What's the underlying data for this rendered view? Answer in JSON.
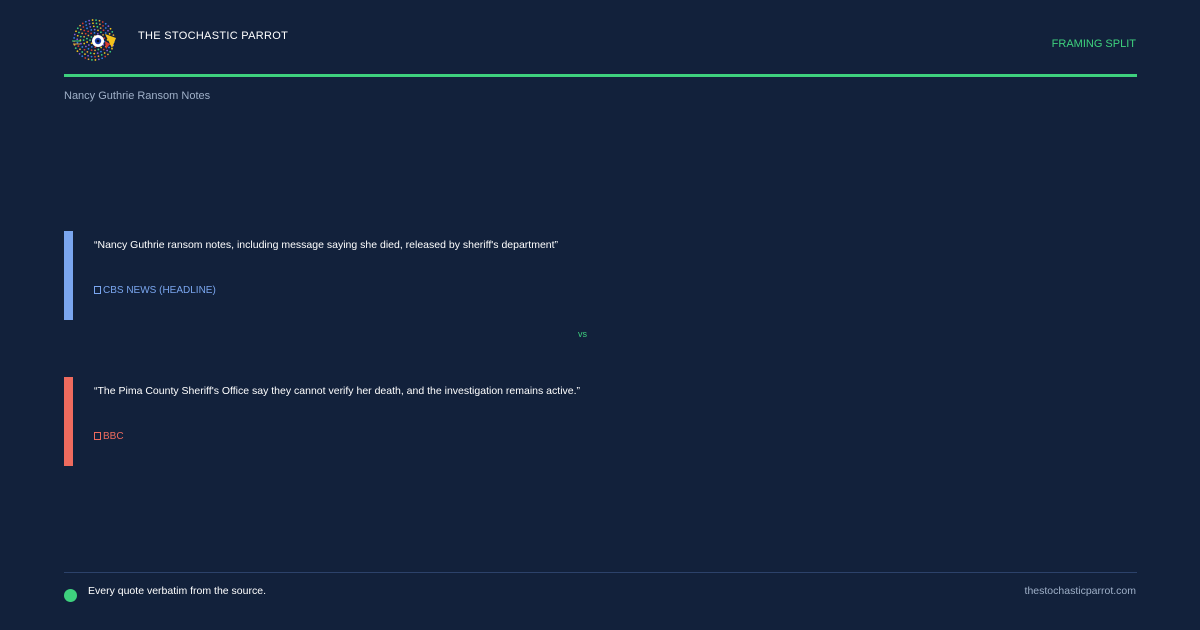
{
  "header": {
    "brand": "THE STOCHASTIC PARROT",
    "tag": "FRAMING SPLIT",
    "topic": "Nancy Guthrie Ransom Notes"
  },
  "quotes": [
    {
      "text": "“Nancy Guthrie ransom notes, including message saying she died, released by sheriff's department”",
      "source": "CBS NEWS (HEADLINE)",
      "color": "#7aa6ef"
    },
    {
      "text": "“The Pima County Sheriff's Office say they cannot verify her death, and the investigation remains active.”",
      "source": "BBC",
      "color": "#ee6b5e"
    }
  ],
  "divider": "vs",
  "footer": {
    "note": "Every quote verbatim from the source.",
    "url": "thestochasticparrot.com"
  },
  "colors": {
    "background": "#12213b",
    "accent": "#3ed17e"
  },
  "icons": {
    "logo": "parrot-logo-icon",
    "source": "source-icon",
    "footer": "status-dot-icon"
  }
}
